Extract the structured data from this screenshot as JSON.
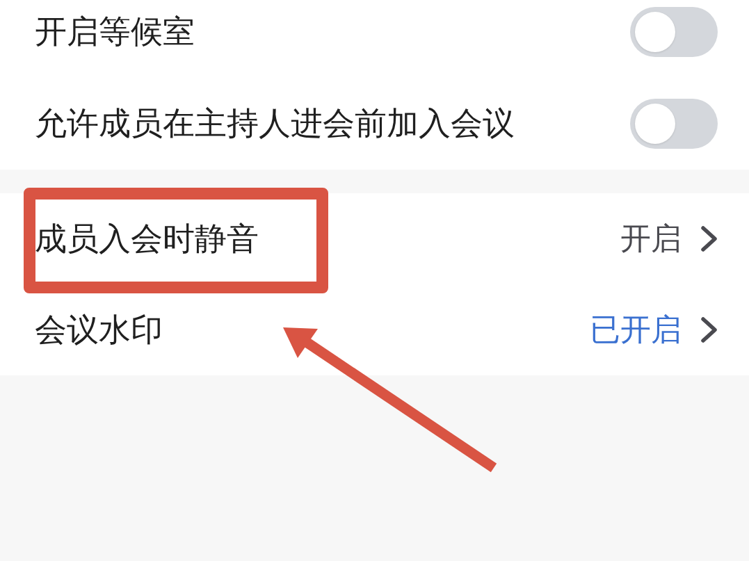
{
  "sections": [
    {
      "rows": [
        {
          "kind": "toggle",
          "label": "开启等候室",
          "on": false,
          "highlighted": false
        },
        {
          "kind": "toggle",
          "label": "允许成员在主持人进会前加入会议",
          "on": false,
          "highlighted": false
        }
      ]
    },
    {
      "rows": [
        {
          "kind": "link",
          "label": "成员入会时静音",
          "value": "开启",
          "accent": false,
          "highlighted": true
        },
        {
          "kind": "link",
          "label": "会议水印",
          "value": "已开启",
          "accent": true,
          "highlighted": false
        }
      ]
    }
  ]
}
